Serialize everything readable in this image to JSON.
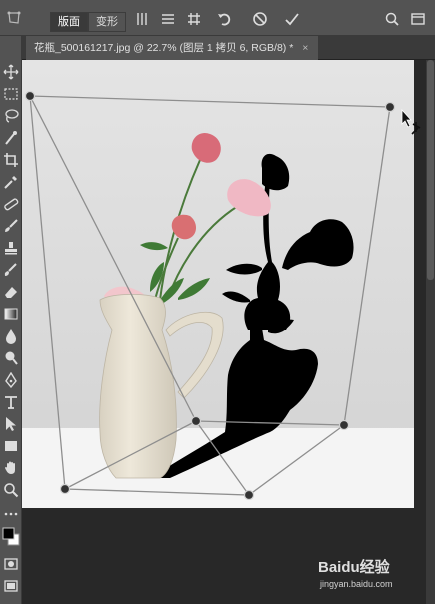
{
  "options_bar": {
    "mode_left": "版面",
    "mode_right": "变形"
  },
  "document": {
    "tab_title": "花瓶_500161217.jpg @ 22.7% (图层 1 拷贝 6, RGB/8) *",
    "close_glyph": "×"
  },
  "watermark": {
    "brand": "Baidu经验",
    "url": "jingyan.baidu.com"
  },
  "colors": {
    "ui_panel": "#535353",
    "ui_dark": "#282828",
    "photo_background": "#dcdcdc",
    "vase": "#e6e0d2",
    "shadow": "#000000",
    "flower": "#e8a0a8",
    "warp_grid": "#8a8a8a"
  },
  "icons": [
    "puppet-warp-icon",
    "split-vertical-icon",
    "split-horizontal-icon",
    "grid-icon",
    "undo-icon",
    "cancel-icon",
    "commit-icon",
    "search-icon",
    "workspace-icon",
    "move-icon",
    "marquee-icon",
    "lasso-icon",
    "quick-select-icon",
    "crop-icon",
    "eyedropper-icon",
    "healing-icon",
    "brush-icon",
    "stamp-icon",
    "history-brush-icon",
    "eraser-icon",
    "gradient-icon",
    "blur-icon",
    "dodge-icon",
    "pen-icon",
    "type-icon",
    "path-select-icon",
    "shape-icon",
    "hand-icon",
    "zoom-icon",
    "foreground-color-icon",
    "background-color-icon",
    "quickmask-icon",
    "screen-mode-icon"
  ]
}
